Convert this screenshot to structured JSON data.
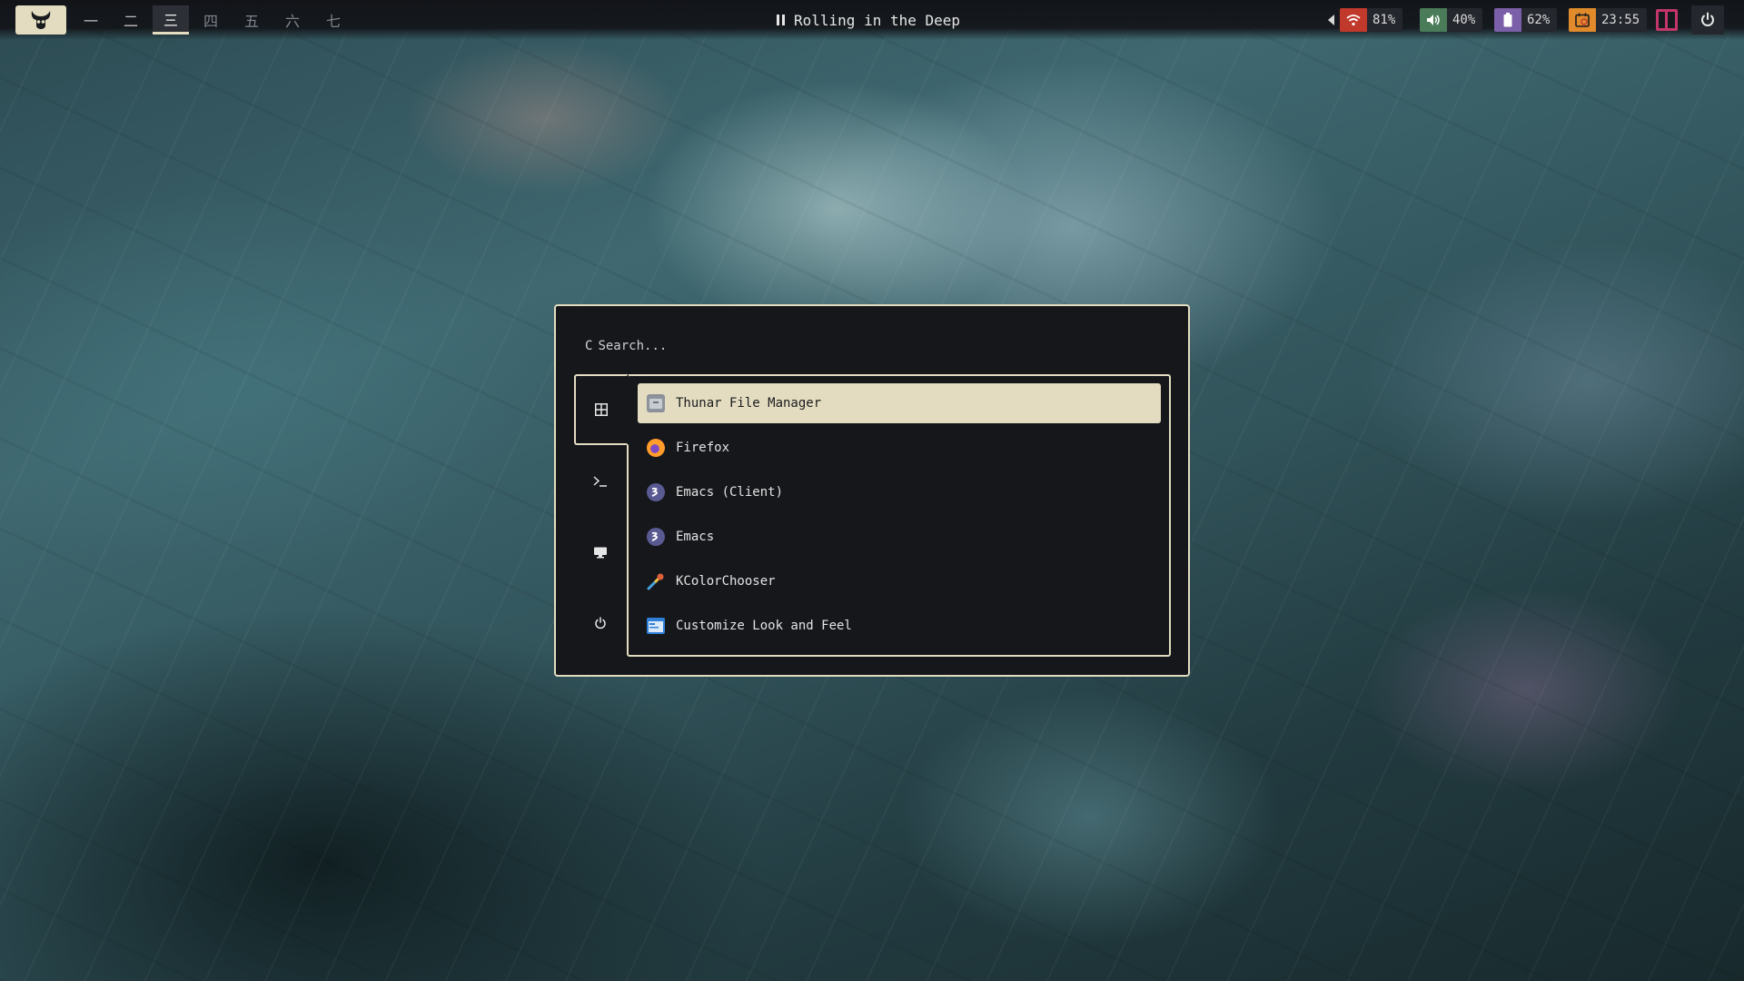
{
  "workspaces": [
    {
      "label": "一",
      "active": false
    },
    {
      "label": "二",
      "active": false
    },
    {
      "label": "三",
      "active": true
    },
    {
      "label": "四",
      "active": false
    },
    {
      "label": "五",
      "active": false
    },
    {
      "label": "六",
      "active": false
    },
    {
      "label": "七",
      "active": false
    }
  ],
  "media": {
    "title": "Rolling in the Deep",
    "state_icon": "pause-icon"
  },
  "tray": {
    "wifi": {
      "value": "81%",
      "icon": "wifi-icon",
      "color": "#c0392b"
    },
    "volume": {
      "value": "40%",
      "icon": "volume-icon",
      "color": "#4a7c59"
    },
    "battery": {
      "value": "62%",
      "icon": "battery-icon",
      "color": "#7b5fa8"
    },
    "clock": {
      "value": "23:55",
      "icon": "calendar-icon",
      "color": "#e08a2c"
    },
    "layout_icon": "layout-icon",
    "power_icon": "power-icon",
    "accent": "#c2366a"
  },
  "launcher": {
    "search_prefix": "C",
    "search_placeholder": "Search...",
    "categories": [
      {
        "name": "apps",
        "icon": "grid-icon"
      },
      {
        "name": "commands",
        "icon": "terminal-icon"
      },
      {
        "name": "windows",
        "icon": "monitor-icon"
      },
      {
        "name": "power",
        "icon": "power-icon"
      }
    ],
    "apps": [
      {
        "label": "Thunar File Manager",
        "icon": "file-manager-icon"
      },
      {
        "label": "Firefox",
        "icon": "firefox-icon"
      },
      {
        "label": "Emacs (Client)",
        "icon": "emacs-icon"
      },
      {
        "label": "Emacs",
        "icon": "emacs-icon"
      },
      {
        "label": "KColorChooser",
        "icon": "color-picker-icon"
      },
      {
        "label": "Customize Look and Feel",
        "icon": "appearance-icon"
      }
    ],
    "accent": "#e3dcc0"
  }
}
